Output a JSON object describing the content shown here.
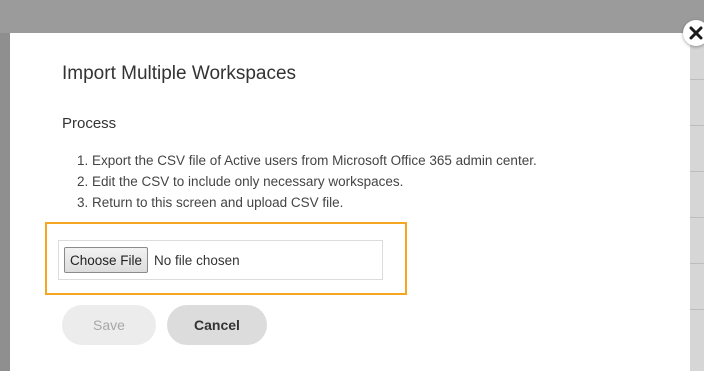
{
  "dialog": {
    "title": "Import Multiple Workspaces",
    "section_label": "Process",
    "steps": [
      "1. Export the CSV file of Active users from Microsoft Office 365 admin center.",
      "2. Edit the CSV to include only necessary workspaces.",
      "3. Return to this screen and upload CSV file."
    ],
    "file_input": {
      "button_label": "Choose File",
      "status_text": "No file chosen"
    },
    "buttons": {
      "save_label": "Save",
      "cancel_label": "Cancel"
    },
    "close_icon": "close-icon"
  },
  "colors": {
    "highlight": "#f5a623",
    "backdrop": "#8f8f8f",
    "save_bg": "#ececec",
    "cancel_bg": "#dcdcdc"
  }
}
